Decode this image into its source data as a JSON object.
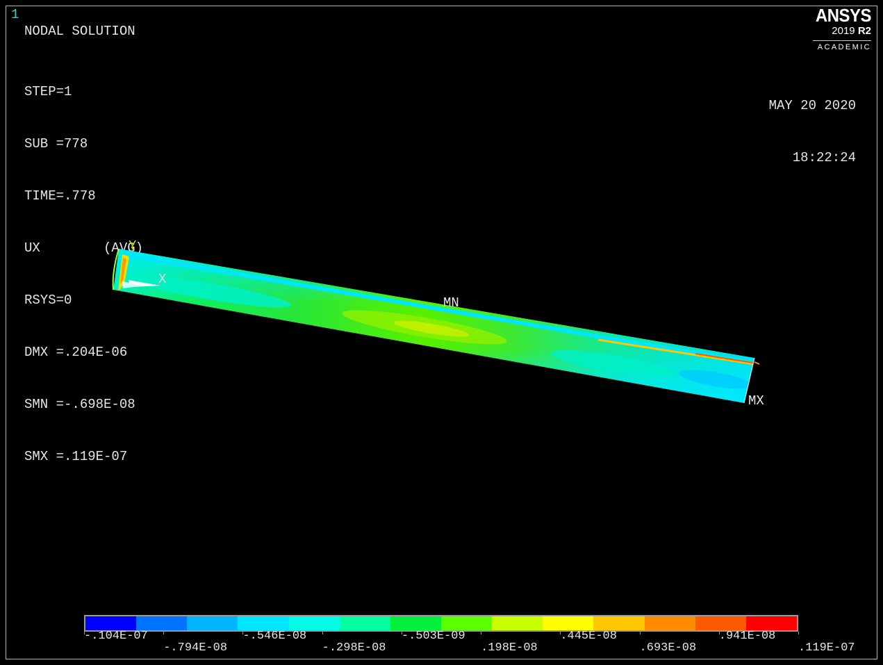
{
  "window": {
    "number": "1"
  },
  "info": {
    "title": "NODAL SOLUTION",
    "lines": [
      "STEP=1",
      "SUB =778",
      "TIME=.778",
      "UX        (AVG)",
      "RSYS=0",
      "DMX =.204E-06",
      "SMN =-.698E-08",
      "SMX =.119E-07"
    ]
  },
  "brand": {
    "name": "ANSYS",
    "version": "2019",
    "release": "R2",
    "edition": "ACADEMIC"
  },
  "datetime": {
    "date": "MAY 20 2020",
    "time": "18:22:24"
  },
  "triad": {
    "y_label": "Y",
    "x_label": "X"
  },
  "markers": {
    "min_label": "MN",
    "max_label": "MX"
  },
  "legend": {
    "colors": [
      "#0000ff",
      "#0073ff",
      "#00b4ff",
      "#00e6ff",
      "#00ffe6",
      "#00ffa0",
      "#00f03c",
      "#5aff00",
      "#c8ff00",
      "#ffff00",
      "#ffc800",
      "#ff8c00",
      "#ff5a00",
      "#ff0000"
    ],
    "labels_top": [
      ".104E-07",
      ".546E-08",
      ".503E-09",
      ".445E-08",
      ".941E-08"
    ],
    "labels_bottom": [
      ".794E-08",
      ".298E-08",
      ".198E-08",
      ".693E-08",
      ".119E-07"
    ],
    "signs_top": [
      "-",
      "-",
      "-",
      "",
      ""
    ],
    "signs_bottom": [
      "-",
      "-",
      "",
      "",
      ""
    ]
  }
}
